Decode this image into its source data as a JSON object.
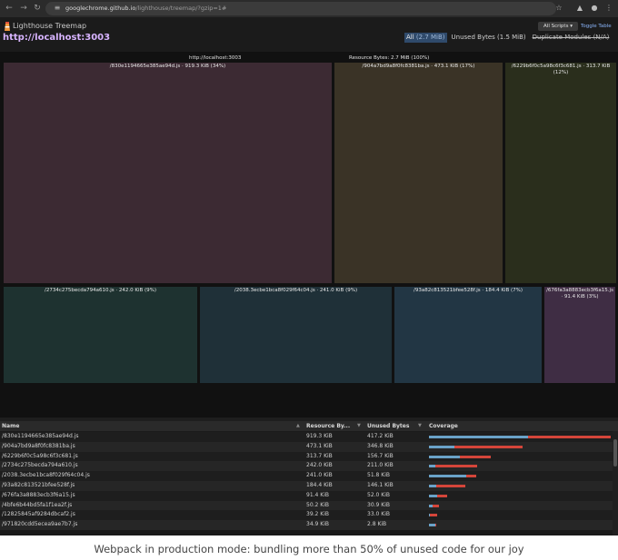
{
  "browser": {
    "url_host": "googlechrome.github.io",
    "url_path": "/lighthouse/treemap/?gzip=1#"
  },
  "header": {
    "app_title": "Lighthouse Treemap",
    "page_url": "http://localhost:3003",
    "bundle_selector": "All Scripts",
    "toggle_table": "Toggle Table",
    "modes": [
      {
        "label": "All",
        "value": "(2.7 MiB)"
      },
      {
        "label": "Unused Bytes",
        "value": "(1.5 MiB)"
      },
      {
        "label": "Duplicate Modules",
        "value": "(N/A)"
      }
    ]
  },
  "treemap": {
    "root_label": "http://localhost:3003",
    "resource_label": "Resource Bytes: 2.7 MiB (100%)",
    "colors": {
      "c1": "#3c2a33",
      "c2": "#3a3326",
      "c3": "#2a2e1c",
      "c4": "#1e3230",
      "c5": "#1f3038",
      "c6": "#223644",
      "c7": "#3f2d44"
    },
    "cells": [
      {
        "label": "/830e1194665e385ae94d.js · 919.3 KiB (34%)"
      },
      {
        "label": "/904a7bd9a8f0fc8381ba.js · 473.1 KiB (17%)"
      },
      {
        "label": "/6229b6f0c5a98c6f3c681.js · 313.7 KiB (12%)"
      },
      {
        "label": "/2734c275becda794a610.js · 242.0 KiB (9%)"
      },
      {
        "label": "/2038.3ecbe1bca8f029f64c04.js · 241.0 KiB (9%)"
      },
      {
        "label": "/93a82c813521bfee528f.js · 184.4 KiB (7%)"
      },
      {
        "label": "/676fa3a8883ecb3f6a15.js · 91.4 KiB (3%)"
      }
    ]
  },
  "table": {
    "headers": {
      "name": "Name",
      "resource": "Resource By...",
      "unused": "Unused Bytes",
      "coverage": "Coverage"
    },
    "rows": [
      {
        "name": "/830e1194665e385ae94d.js",
        "resource": "919.3 KiB",
        "unused": "417.2 KiB",
        "used_frac": 0.546,
        "unused_frac": 0.454,
        "total_frac": 1.0
      },
      {
        "name": "/904a7bd9a8f0fc8381ba.js",
        "resource": "473.1 KiB",
        "unused": "346.8 KiB",
        "used_frac": 0.267,
        "unused_frac": 0.733,
        "total_frac": 0.515
      },
      {
        "name": "/6229b6f0c5a98c6f3c681.js",
        "resource": "313.7 KiB",
        "unused": "156.7 KiB",
        "used_frac": 0.5,
        "unused_frac": 0.5,
        "total_frac": 0.341
      },
      {
        "name": "/2734c275becda794a610.js",
        "resource": "242.0 KiB",
        "unused": "211.0 KiB",
        "used_frac": 0.128,
        "unused_frac": 0.872,
        "total_frac": 0.263
      },
      {
        "name": "/2038.3ecbe1bca8f029f64c04.js",
        "resource": "241.0 KiB",
        "unused": "51.8 KiB",
        "used_frac": 0.785,
        "unused_frac": 0.215,
        "total_frac": 0.262
      },
      {
        "name": "/93a82c813521bfee528f.js",
        "resource": "184.4 KiB",
        "unused": "146.1 KiB",
        "used_frac": 0.208,
        "unused_frac": 0.792,
        "total_frac": 0.2
      },
      {
        "name": "/676fa3a8883ecb3f6a15.js",
        "resource": "91.4 KiB",
        "unused": "52.0 KiB",
        "used_frac": 0.431,
        "unused_frac": 0.569,
        "total_frac": 0.099
      },
      {
        "name": "/4bfe6b44bd5fa1f1ea2f.js",
        "resource": "50.2 KiB",
        "unused": "30.9 KiB",
        "used_frac": 0.384,
        "unused_frac": 0.616,
        "total_frac": 0.055
      },
      {
        "name": "/12825845af9284dbcaf2.js",
        "resource": "39.2 KiB",
        "unused": "33.0 KiB",
        "used_frac": 0.158,
        "unused_frac": 0.842,
        "total_frac": 0.043
      },
      {
        "name": "/971820cdd5ecea9ae7b7.js",
        "resource": "34.9 KiB",
        "unused": "2.8 KiB",
        "used_frac": 0.92,
        "unused_frac": 0.08,
        "total_frac": 0.038
      }
    ]
  },
  "caption": "Webpack in production mode: bundling more than 50% of unused code for our joy"
}
